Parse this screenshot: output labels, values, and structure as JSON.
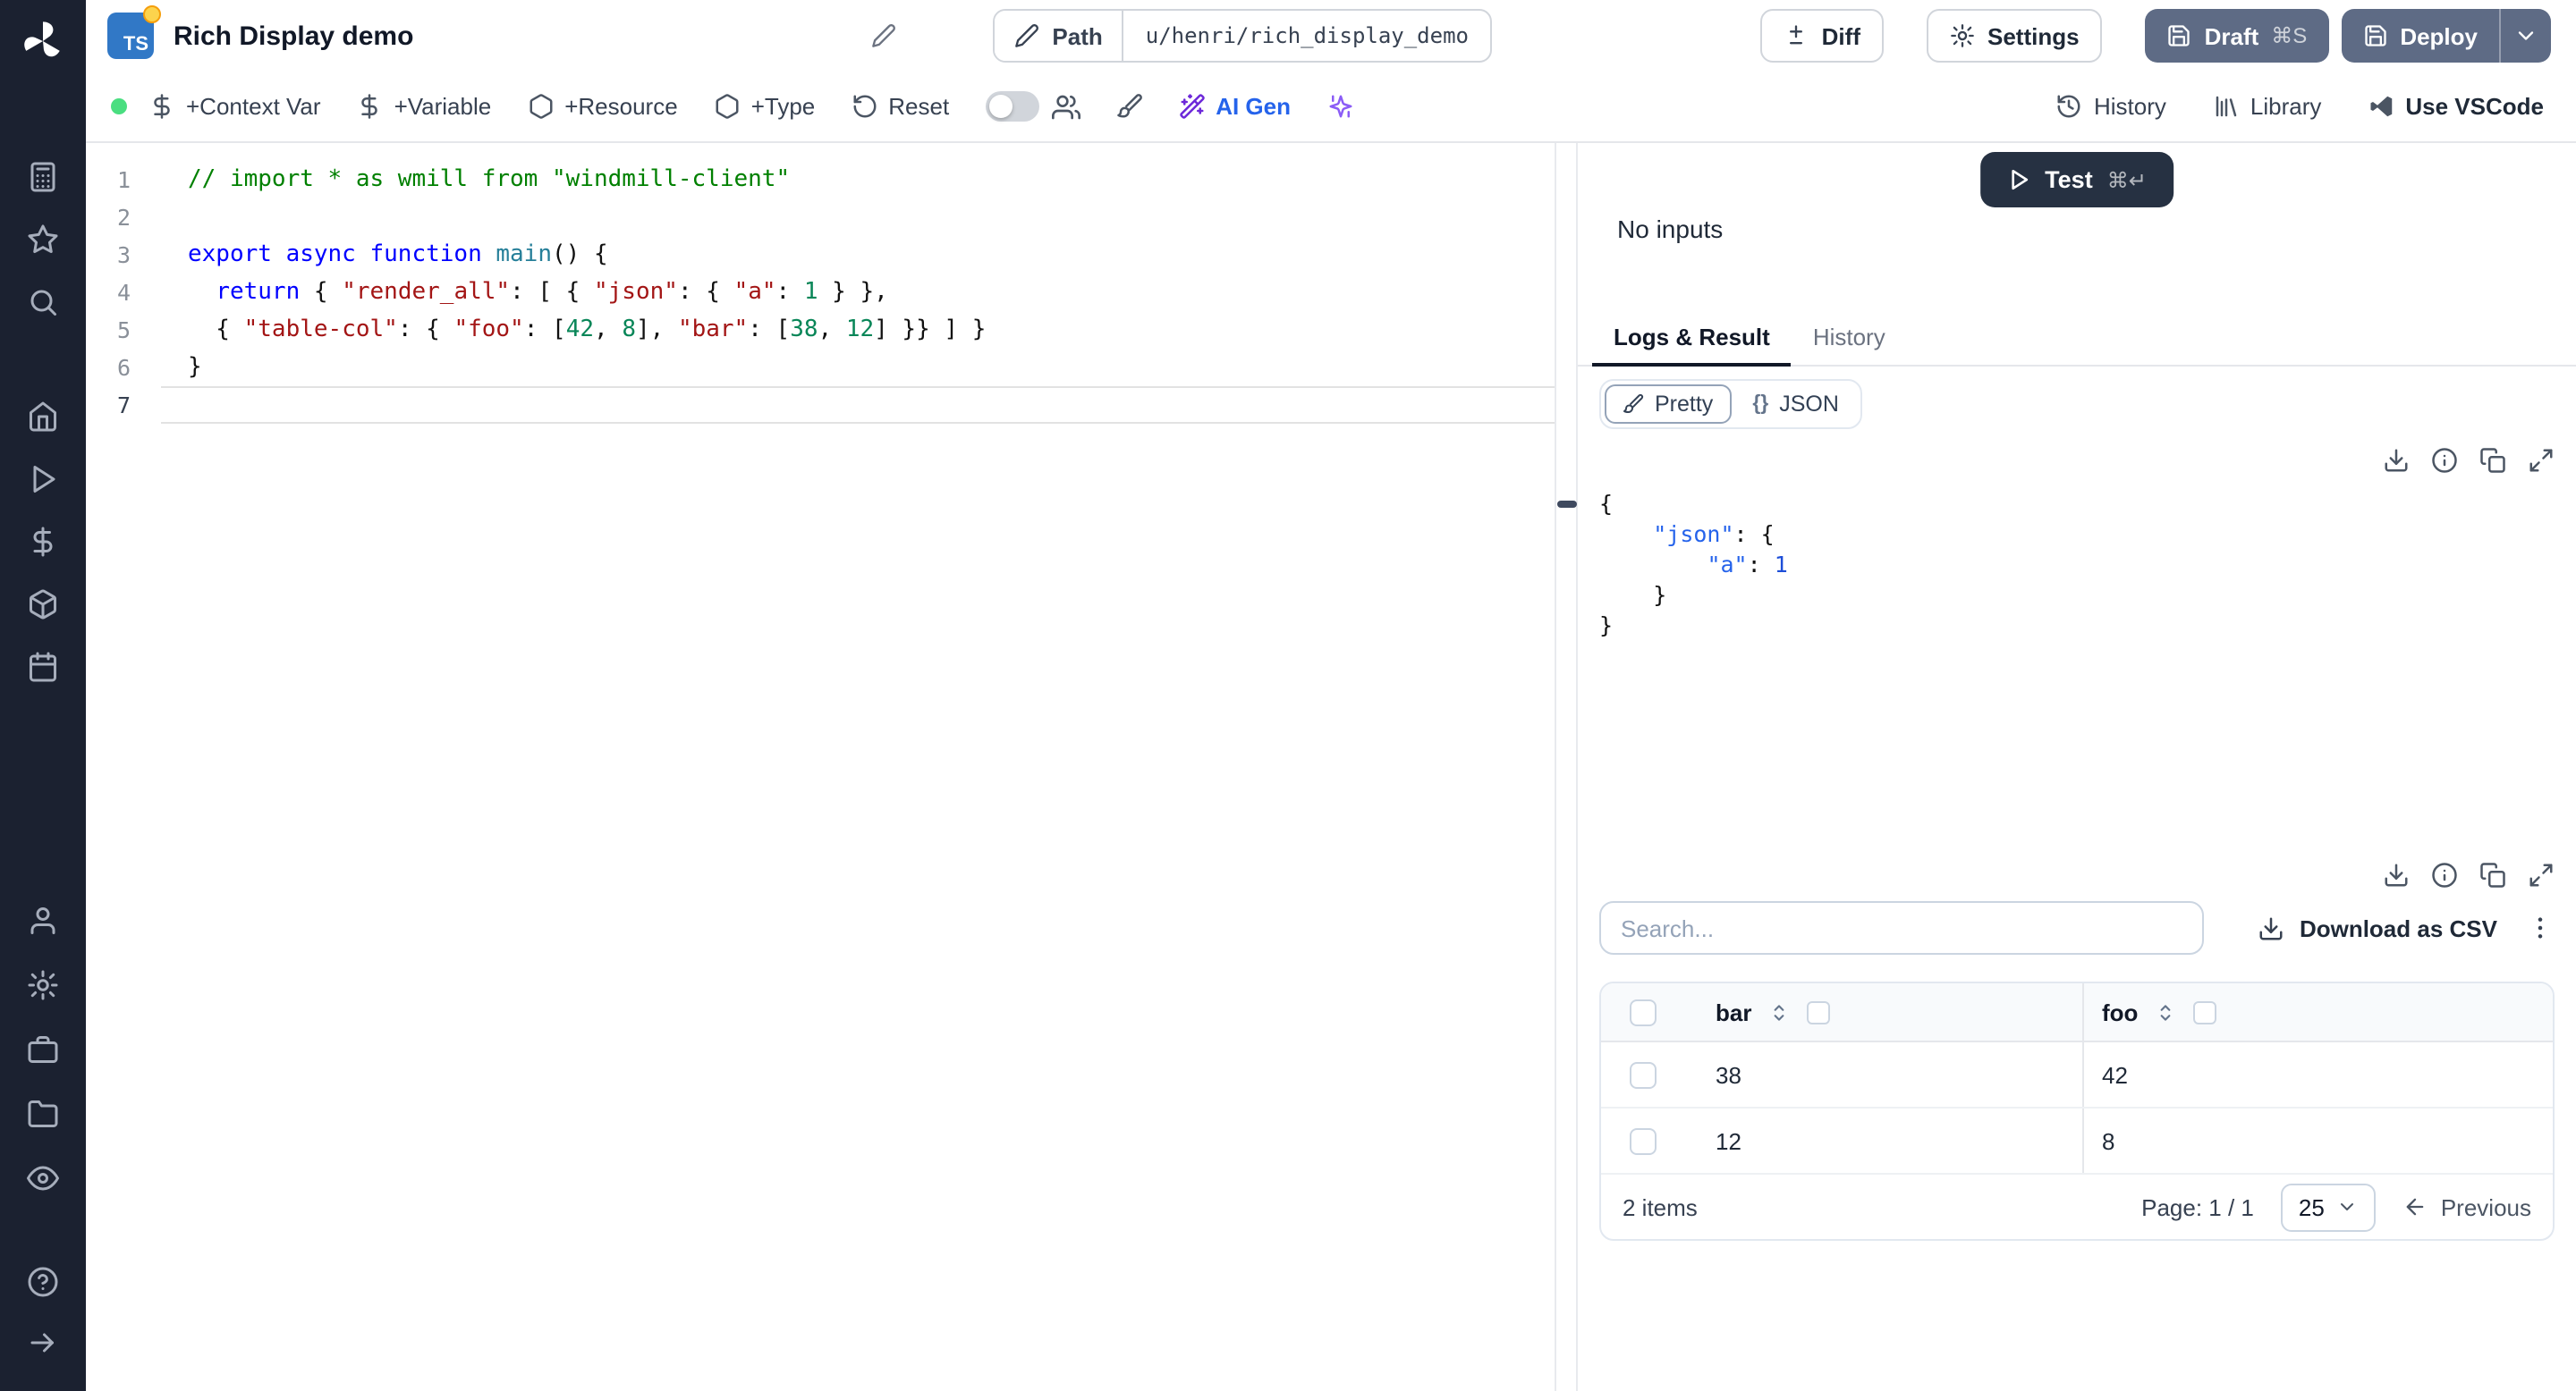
{
  "header": {
    "badge": "TS",
    "title": "Rich Display demo",
    "path_label": "Path",
    "path_value": "u/henri/rich_display_demo",
    "diff_label": "Diff",
    "settings_label": "Settings",
    "draft_label": "Draft",
    "draft_shortcut": "⌘S",
    "deploy_label": "Deploy"
  },
  "toolbar": {
    "context_var": "+Context Var",
    "variable": "+Variable",
    "resource": "+Resource",
    "type": "+Type",
    "reset": "Reset",
    "ai_gen": "AI Gen",
    "history": "History",
    "library": "Library",
    "vscode": "Use VSCode"
  },
  "sidebar": {
    "items": [
      "apps",
      "favorites",
      "search",
      "home",
      "runs",
      "variables",
      "resources",
      "schedules",
      "user",
      "settings",
      "workers",
      "folders",
      "audit",
      "help",
      "collapse"
    ]
  },
  "editor": {
    "lines": [
      {
        "num": "1",
        "tokens": [
          [
            "// import * as wmill from \"windmill-client\"",
            "comment"
          ]
        ]
      },
      {
        "num": "2",
        "tokens": []
      },
      {
        "num": "3",
        "tokens": [
          [
            "export async function ",
            "keyword"
          ],
          [
            "main",
            "fn"
          ],
          [
            "() {",
            "plain"
          ]
        ]
      },
      {
        "num": "4",
        "tokens": [
          [
            "  ",
            "plain"
          ],
          [
            "return",
            "keyword"
          ],
          [
            " { ",
            "plain"
          ],
          [
            "\"render_all\"",
            "string"
          ],
          [
            ": [ { ",
            "plain"
          ],
          [
            "\"json\"",
            "string"
          ],
          [
            ": { ",
            "plain"
          ],
          [
            "\"a\"",
            "string"
          ],
          [
            ": ",
            "plain"
          ],
          [
            "1",
            "number"
          ],
          [
            " } },",
            "plain"
          ]
        ]
      },
      {
        "num": "5",
        "tokens": [
          [
            "  { ",
            "plain"
          ],
          [
            "\"table-col\"",
            "string"
          ],
          [
            ": { ",
            "plain"
          ],
          [
            "\"foo\"",
            "string"
          ],
          [
            ": [",
            "plain"
          ],
          [
            "42",
            "number"
          ],
          [
            ", ",
            "plain"
          ],
          [
            "8",
            "number"
          ],
          [
            "], ",
            "plain"
          ],
          [
            "\"bar\"",
            "string"
          ],
          [
            ": [",
            "plain"
          ],
          [
            "38",
            "number"
          ],
          [
            ", ",
            "plain"
          ],
          [
            "12",
            "number"
          ],
          [
            "] }} ] }",
            "plain"
          ]
        ]
      },
      {
        "num": "6",
        "tokens": [
          [
            "}",
            "plain"
          ]
        ]
      },
      {
        "num": "7",
        "tokens": [],
        "current": true
      }
    ]
  },
  "panel": {
    "test_label": "Test",
    "test_shortcut": "⌘↵",
    "no_inputs": "No inputs",
    "tabs": [
      {
        "label": "Logs & Result",
        "active": true
      },
      {
        "label": "History",
        "active": false
      }
    ],
    "toggle": {
      "pretty": "Pretty",
      "json_prefix": "{}",
      "json": "JSON"
    },
    "result_lines": [
      [
        [
          "{",
          "plain"
        ]
      ],
      [
        [
          "    ",
          "plain"
        ],
        [
          "\"json\"",
          "key"
        ],
        [
          ": {",
          "plain"
        ]
      ],
      [
        [
          "        ",
          "plain"
        ],
        [
          "\"a\"",
          "key"
        ],
        [
          ": ",
          "plain"
        ],
        [
          "1",
          "value"
        ]
      ],
      [
        [
          "    }",
          "plain"
        ]
      ],
      [
        [
          "}",
          "plain"
        ]
      ]
    ],
    "search_placeholder": "Search...",
    "download_csv": "Download as CSV",
    "table": {
      "columns": [
        "bar",
        "foo"
      ],
      "rows": [
        [
          "38",
          "42"
        ],
        [
          "12",
          "8"
        ]
      ],
      "items_text": "2 items",
      "page_label": "Page: 1 / 1",
      "page_size": "25",
      "previous_label": "Previous"
    }
  }
}
